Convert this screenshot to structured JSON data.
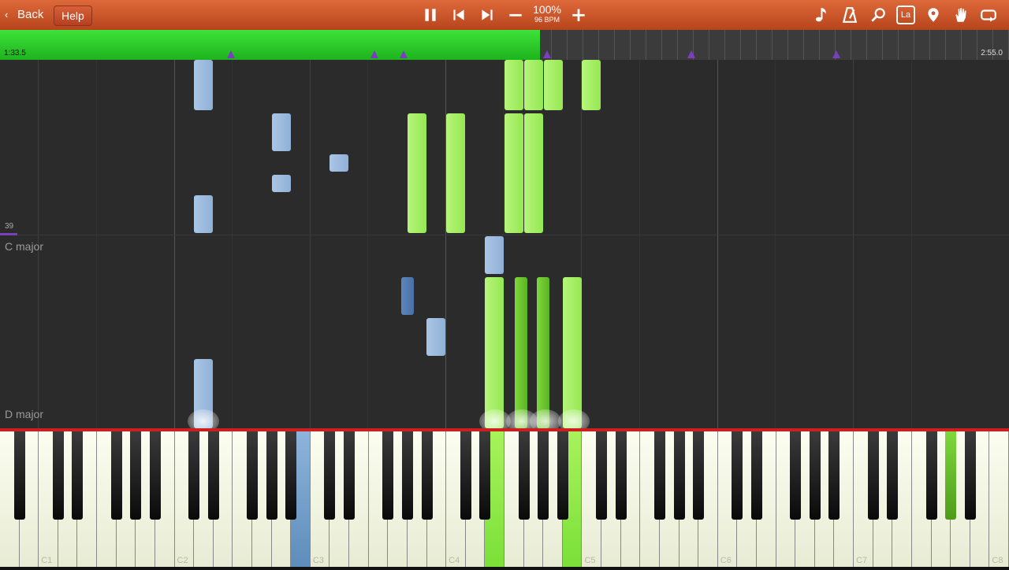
{
  "toolbar": {
    "back_label": "Back",
    "help_label": "Help",
    "speed_percent": "100%",
    "tempo": "96 BPM",
    "icons": [
      "pause-icon",
      "skip-back-icon",
      "skip-forward-icon",
      "minus-icon",
      "plus-icon",
      "music-note-icon",
      "metronome-icon",
      "magnifier-icon",
      "key-label-icon",
      "location-pin-icon",
      "hand-icon",
      "loop-icon"
    ],
    "key_label_badge": "La",
    "bar_color": "#c9532a"
  },
  "timeline": {
    "current_time": "1:33.5",
    "total_time": "2:55.0",
    "progress_fraction": 0.535,
    "progress_color": "#2ed12a",
    "marker_color": "#7a3fbf"
  },
  "roll": {
    "measure_number": "39",
    "key_signatures": [
      "C major",
      "D major"
    ],
    "note_colors": {
      "left_hand": "#9fbde0",
      "right_hand": "#a9f06a"
    }
  },
  "keyboard": {
    "octave_labels": [
      "C1",
      "C2",
      "C3",
      "C4",
      "C5",
      "C6",
      "C7",
      "C8"
    ],
    "active_color_left": "#6a9ccb",
    "active_color_right": "#8aeb40"
  }
}
